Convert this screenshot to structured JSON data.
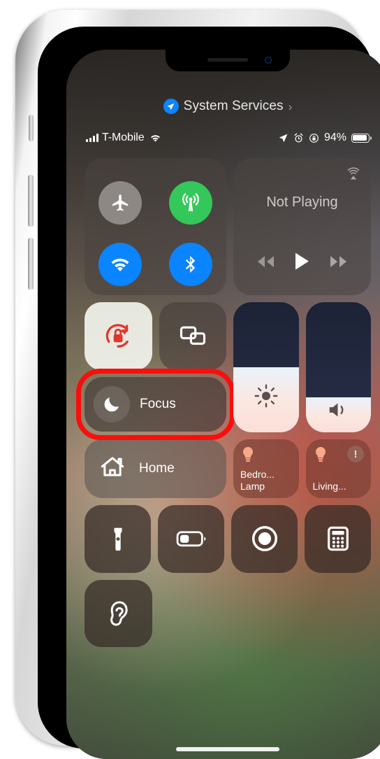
{
  "header": {
    "location_icon": "location-arrow-icon",
    "title": "System Services",
    "chevron": "›"
  },
  "status_bar": {
    "signal_icon": "cellular-signal-bars-icon",
    "carrier": "T-Mobile",
    "wifi_icon": "wifi-icon",
    "location_icon": "location-arrow-icon",
    "alarm_icon": "alarm-clock-icon",
    "rotation_lock_icon": "rotation-lock-icon",
    "battery_percent": "94%",
    "battery_level": 94,
    "battery_icon": "battery-icon"
  },
  "connectivity": {
    "airplane": {
      "name": "Airplane Mode",
      "icon": "airplane-icon",
      "active": false
    },
    "cellular": {
      "name": "Cellular Data",
      "icon": "cellular-antenna-icon",
      "active": true
    },
    "wifi": {
      "name": "Wi-Fi",
      "icon": "wifi-icon",
      "active": true
    },
    "bluetooth": {
      "name": "Bluetooth",
      "icon": "bluetooth-icon",
      "active": true
    }
  },
  "media": {
    "airplay_icon": "airplay-audio-icon",
    "now_playing": "Not Playing",
    "rewind_icon": "rewind-icon",
    "play_icon": "play-icon",
    "forward_icon": "fast-forward-icon"
  },
  "toggles": {
    "rotation_lock": {
      "label": "Rotation Lock",
      "icon": "rotation-lock-icon",
      "active": true
    },
    "screen_mirroring": {
      "label": "Screen Mirroring",
      "icon": "screen-mirroring-icon",
      "active": false
    }
  },
  "focus": {
    "label": "Focus",
    "icon": "moon-icon",
    "highlighted": true,
    "highlight_color": "#fb0d0d"
  },
  "sliders": {
    "brightness": {
      "label": "Brightness",
      "icon": "sun-icon",
      "value": 50
    },
    "volume": {
      "label": "Volume",
      "icon": "speaker-icon",
      "value": 27
    }
  },
  "home": {
    "label": "Home",
    "icon": "home-icon",
    "accessories": [
      {
        "name": "Bedro... Lamp",
        "icon": "lightbulb-icon",
        "warning": false
      },
      {
        "name": "Living...",
        "icon": "lightbulb-icon",
        "warning": true,
        "warning_icon": "exclamation-icon"
      }
    ]
  },
  "utilities": [
    {
      "label": "Flashlight",
      "icon": "flashlight-icon"
    },
    {
      "label": "Low Power Mode",
      "icon": "battery-icon"
    },
    {
      "label": "Screen Recording",
      "icon": "screen-recording-icon"
    },
    {
      "label": "Calculator",
      "icon": "calculator-icon"
    }
  ],
  "accessibility": [
    {
      "label": "Hearing",
      "icon": "ear-icon"
    }
  ],
  "device": {
    "home_indicator": "home-indicator",
    "notch": "notch",
    "earpiece": "earpiece-speaker",
    "camera": "front-camera"
  },
  "colors": {
    "accent_blue": "#0a84ff",
    "active_green": "#34c759",
    "highlight_red": "#fb0d0d",
    "inactive_gray": "#a09c98"
  }
}
